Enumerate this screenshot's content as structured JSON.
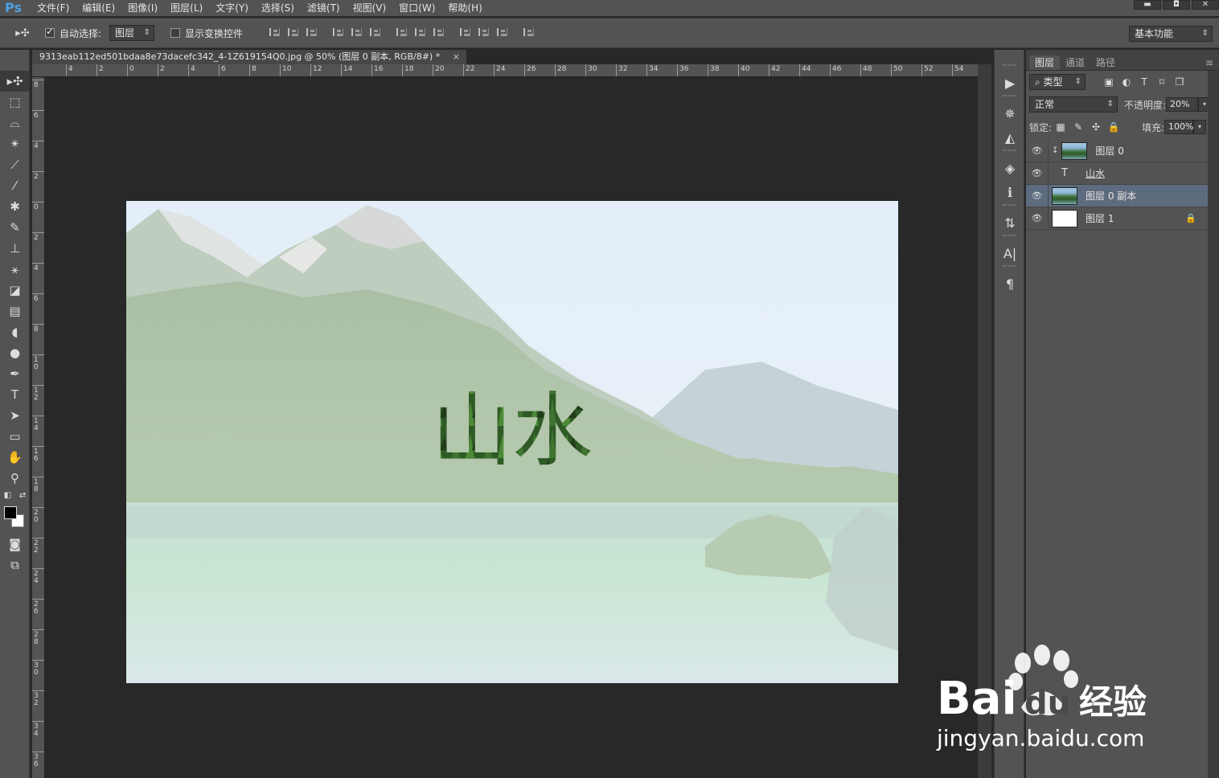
{
  "app": {
    "logo": "Ps"
  },
  "menu": [
    "文件(F)",
    "编辑(E)",
    "图像(I)",
    "图层(L)",
    "文字(Y)",
    "选择(S)",
    "滤镜(T)",
    "视图(V)",
    "窗口(W)",
    "帮助(H)"
  ],
  "window_controls": {
    "minimize": "▬",
    "restore": "◘",
    "close": "✕"
  },
  "options_bar": {
    "tool_glyph": "▸✣",
    "auto_select_label": "自动选择:",
    "auto_select_checked": true,
    "auto_select_value": "图层",
    "show_transform_label": "显示变换控件",
    "show_transform_checked": false,
    "workspace": "基本功能"
  },
  "document": {
    "tab_title": "9313eab112ed501bdaa8e73dacefc342_4-1Z619154Q0.jpg @ 50% (图层 0 副本, RGB/8#) *",
    "tab_close": "×",
    "canvas_text": "山水",
    "ruler_h_labels": [
      "4",
      "2",
      "0",
      "2",
      "4",
      "6",
      "8",
      "10",
      "12",
      "14",
      "16",
      "18",
      "20",
      "22",
      "24",
      "26",
      "28",
      "30",
      "32",
      "34",
      "36",
      "38",
      "40",
      "42",
      "44",
      "46",
      "48",
      "50",
      "52",
      "54"
    ],
    "ruler_v_labels": [
      "8",
      "6",
      "4",
      "2",
      "0",
      "2",
      "4",
      "6",
      "8",
      "10",
      "12",
      "14",
      "16",
      "18",
      "20",
      "22",
      "24",
      "26",
      "28",
      "30",
      "32",
      "34",
      "36"
    ]
  },
  "tools": [
    {
      "name": "move-tool",
      "glyph": "▸✣"
    },
    {
      "name": "marquee-tool",
      "glyph": "⬚"
    },
    {
      "name": "lasso-tool",
      "glyph": "⌓"
    },
    {
      "name": "magic-wand-tool",
      "glyph": "✴"
    },
    {
      "name": "crop-tool",
      "glyph": "⟋"
    },
    {
      "name": "eyedropper-tool",
      "glyph": "⁄"
    },
    {
      "name": "healing-brush-tool",
      "glyph": "✱"
    },
    {
      "name": "brush-tool",
      "glyph": "✎"
    },
    {
      "name": "clone-stamp-tool",
      "glyph": "⊥"
    },
    {
      "name": "history-brush-tool",
      "glyph": "⚹"
    },
    {
      "name": "eraser-tool",
      "glyph": "◪"
    },
    {
      "name": "gradient-tool",
      "glyph": "▤"
    },
    {
      "name": "blur-tool",
      "glyph": "◖"
    },
    {
      "name": "dodge-tool",
      "glyph": "●"
    },
    {
      "name": "pen-tool",
      "glyph": "✒"
    },
    {
      "name": "type-tool",
      "glyph": "T"
    },
    {
      "name": "path-selection-tool",
      "glyph": "➤"
    },
    {
      "name": "rectangle-tool",
      "glyph": "▭"
    },
    {
      "name": "hand-tool",
      "glyph": "✋"
    },
    {
      "name": "zoom-tool",
      "glyph": "⚲"
    }
  ],
  "swap_icons": {
    "default": "◧",
    "swap": "⇄"
  },
  "mode_icons": {
    "quick_mask": "◙",
    "screen_mode": "⧉"
  },
  "strip_icons": [
    {
      "name": "play-icon",
      "glyph": "▶"
    },
    {
      "name": "compass-icon",
      "glyph": "✵"
    },
    {
      "name": "histogram-icon",
      "glyph": "◭"
    },
    {
      "name": "3d-icon",
      "glyph": "◈"
    },
    {
      "name": "info-icon",
      "glyph": "ℹ"
    },
    {
      "name": "adjust-icon",
      "glyph": "⇅"
    },
    {
      "name": "character-icon",
      "glyph": "A|"
    },
    {
      "name": "paragraph-icon",
      "glyph": "¶"
    }
  ],
  "layers_panel": {
    "tabs": [
      "图层",
      "通道",
      "路径"
    ],
    "menu_glyph": "≡",
    "filter_label": "⌕ 类型",
    "filter_icons": [
      "▣",
      "◐",
      "T",
      "⌑",
      "❒"
    ],
    "blend_mode": "正常",
    "opacity_label": "不透明度:",
    "opacity_value": "20%",
    "lock_label": "锁定:",
    "lock_icons": [
      "▦",
      "✎",
      "✣",
      "🔒"
    ],
    "fill_label": "填充:",
    "fill_value": "100%",
    "dd_glyph": "▾",
    "layers": [
      {
        "name": "图层 0",
        "type": "photo",
        "clipped": true,
        "selected": false,
        "locked": false
      },
      {
        "name": "山水",
        "type": "text",
        "clipped": false,
        "selected": false,
        "locked": false
      },
      {
        "name": "图层 0 副本",
        "type": "photo",
        "clipped": false,
        "selected": true,
        "locked": false
      },
      {
        "name": "图层 1",
        "type": "white",
        "clipped": false,
        "selected": false,
        "locked": true
      }
    ],
    "eye_glyph": "👁",
    "clip_glyph": "↧",
    "type_glyph": "T",
    "lock_glyph": "🔒"
  },
  "watermark": {
    "brand": "Bai",
    "brand2": "du",
    "site_cn": "经验",
    "url": "jingyan.baidu.com"
  }
}
